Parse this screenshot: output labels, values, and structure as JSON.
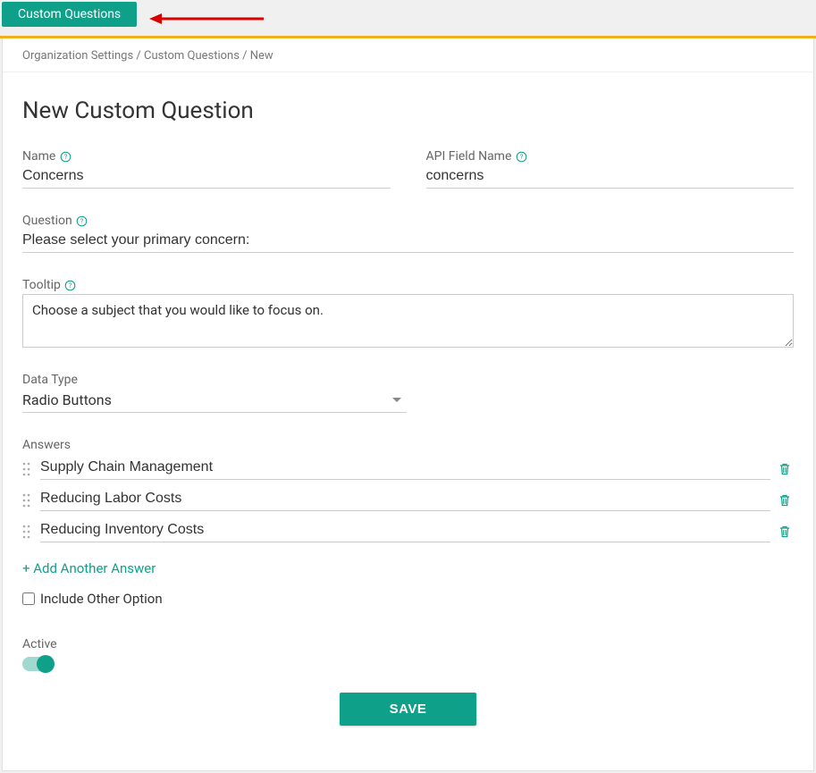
{
  "topbar": {
    "tab_label": "Custom Questions"
  },
  "breadcrumb": {
    "seg1": "Organization Settings",
    "seg2": "Custom Questions",
    "seg3": "New"
  },
  "page": {
    "title": "New Custom Question"
  },
  "fields": {
    "name": {
      "label": "Name",
      "value": "Concerns"
    },
    "api_field": {
      "label": "API Field Name",
      "value": "concerns"
    },
    "question": {
      "label": "Question",
      "value": "Please select your primary concern:"
    },
    "tooltip": {
      "label": "Tooltip",
      "value": "Choose a subject that you would like to focus on."
    },
    "data_type": {
      "label": "Data Type",
      "value": "Radio Buttons"
    },
    "answers_label": "Answers",
    "answers": [
      {
        "value": "Supply Chain Management"
      },
      {
        "value": "Reducing Labor Costs"
      },
      {
        "value": "Reducing Inventory Costs"
      }
    ],
    "add_answer_label": "+ Add Another Answer",
    "include_other_label": "Include Other Option",
    "active_label": "Active"
  },
  "buttons": {
    "save": "SAVE"
  },
  "icons": {
    "help": "help-circle-icon",
    "drag": "drag-handle-icon",
    "trash": "trash-icon",
    "caret": "chevron-down-icon"
  },
  "colors": {
    "accent": "#0fa08a",
    "warn_bar": "#efb01d"
  }
}
